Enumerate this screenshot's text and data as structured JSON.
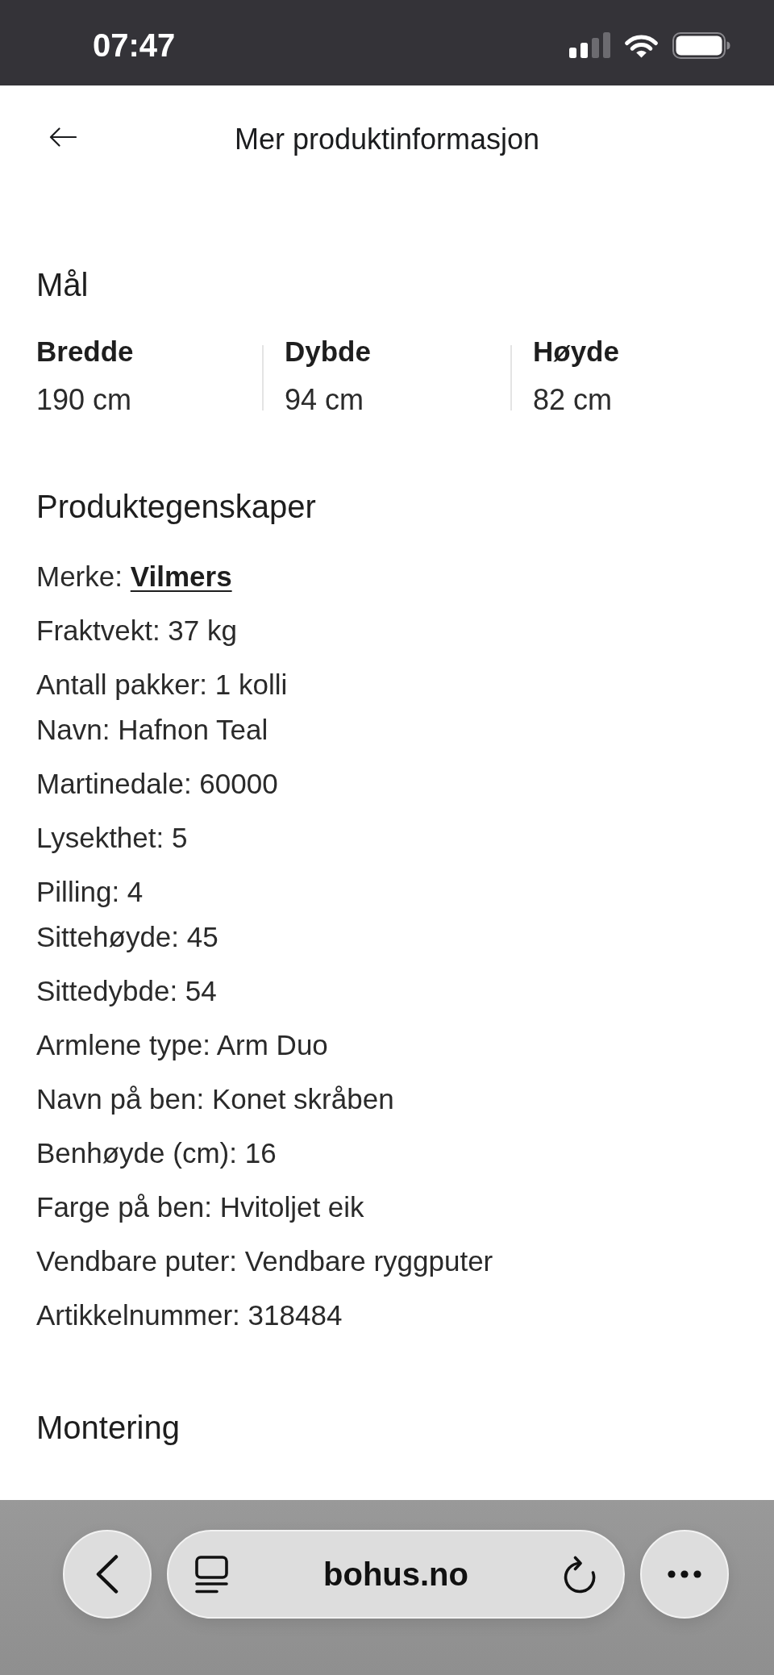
{
  "status_bar": {
    "time": "07:47"
  },
  "header": {
    "title": "Mer produktinformasjon"
  },
  "dimensions": {
    "heading": "Mål",
    "items": [
      {
        "label": "Bredde",
        "value": "190 cm"
      },
      {
        "label": "Dybde",
        "value": "94 cm"
      },
      {
        "label": "Høyde",
        "value": "82 cm"
      }
    ]
  },
  "properties": {
    "heading": "Produktegenskaper",
    "groups": [
      {
        "items": [
          {
            "text": "Merke:",
            "link": "Vilmers"
          },
          {
            "text": "Fraktvekt: 37 kg"
          },
          {
            "text": "Antall pakker: 1 kolli"
          }
        ]
      },
      {
        "items": [
          {
            "text": "Navn: Hafnon Teal"
          },
          {
            "text": "Martinedale: 60000"
          },
          {
            "text": "Lysekthet: 5"
          },
          {
            "text": "Pilling: 4"
          }
        ]
      },
      {
        "items": [
          {
            "text": "Sittehøyde: 45"
          },
          {
            "text": "Sittedybde: 54"
          },
          {
            "text": "Armlene type: Arm Duo"
          },
          {
            "text": "Navn på ben: Konet skråben"
          },
          {
            "text": "Benhøyde (cm): 16"
          },
          {
            "text": "Farge på ben: Hvitoljet eik"
          },
          {
            "text": "Vendbare puter: Vendbare ryggputer"
          },
          {
            "text": "Artikkelnummer: 318484"
          }
        ]
      }
    ]
  },
  "assembly": {
    "heading": "Montering"
  },
  "browser_bar": {
    "url": "bohus.no"
  }
}
